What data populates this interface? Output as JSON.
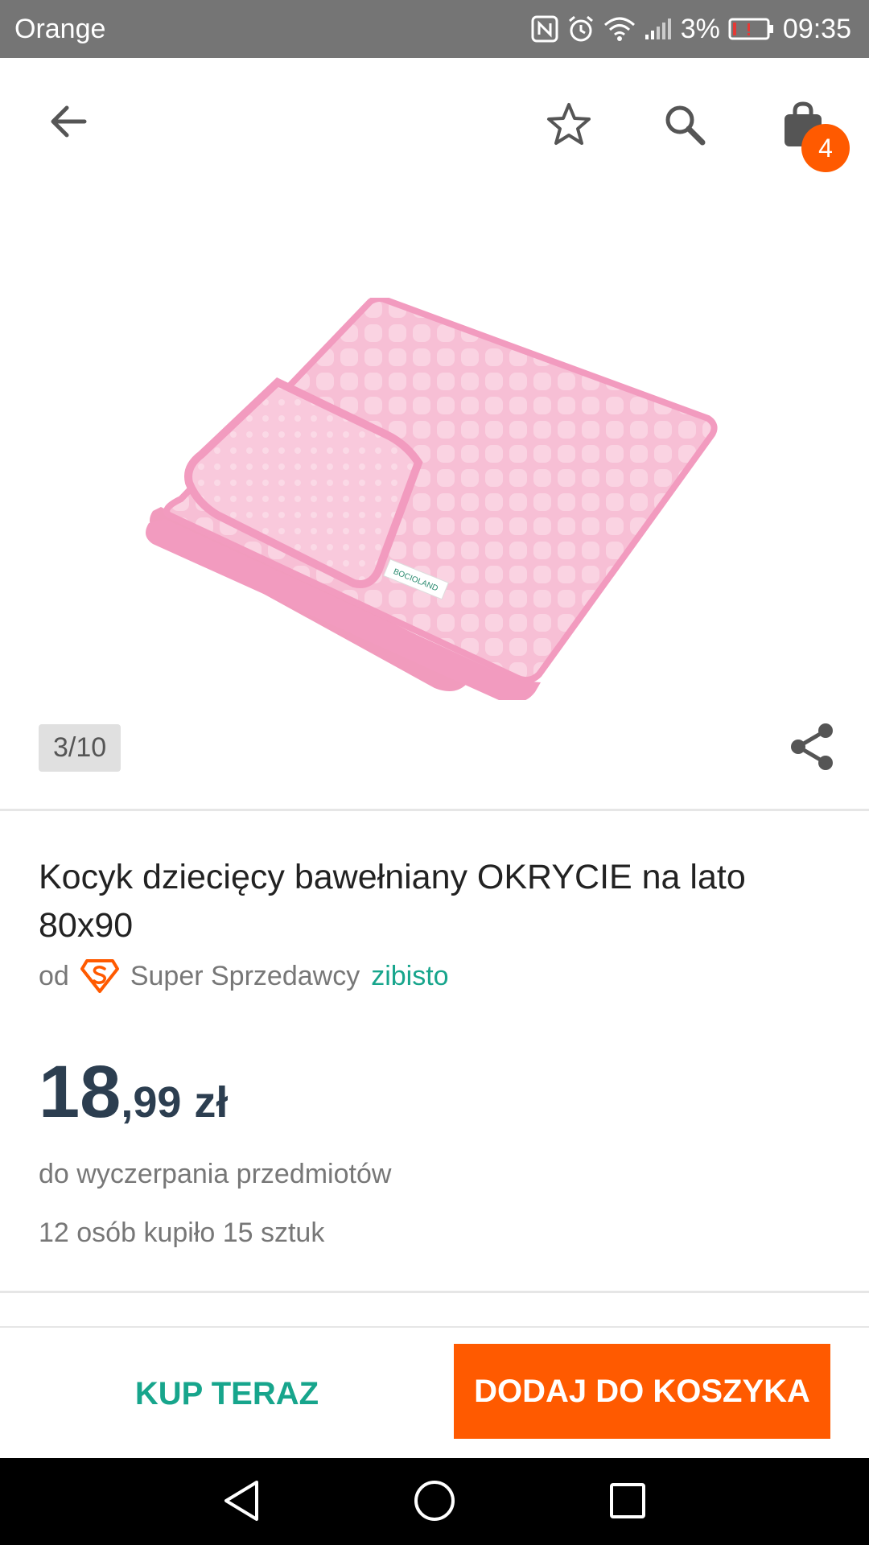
{
  "status_bar": {
    "carrier": "Orange",
    "battery_percent": "3%",
    "time": "09:35"
  },
  "top_bar": {
    "cart_count": "4"
  },
  "gallery": {
    "counter": "3/10",
    "label_brand": "BOCIOLAND"
  },
  "product": {
    "title": "Kocyk dziecięcy bawełniany OKRYCIE na lato 80x90",
    "seller_prefix": "od",
    "seller_badge": "Super Sprzedawcy",
    "seller_name": "zibisto",
    "price_whole": "18",
    "price_fraction": ",99",
    "price_currency": "zł",
    "availability": "do wyczerpania przedmiotów",
    "buyers": "12 osób kupiło 15 sztuk"
  },
  "actions": {
    "buy_now": "KUP TERAZ",
    "add_to_cart": "DODAJ DO KOSZYKA"
  },
  "colors": {
    "accent_orange": "#ff5a00",
    "accent_teal": "#17a58c",
    "price_text": "#2c3e50",
    "status_bar": "#757575"
  }
}
